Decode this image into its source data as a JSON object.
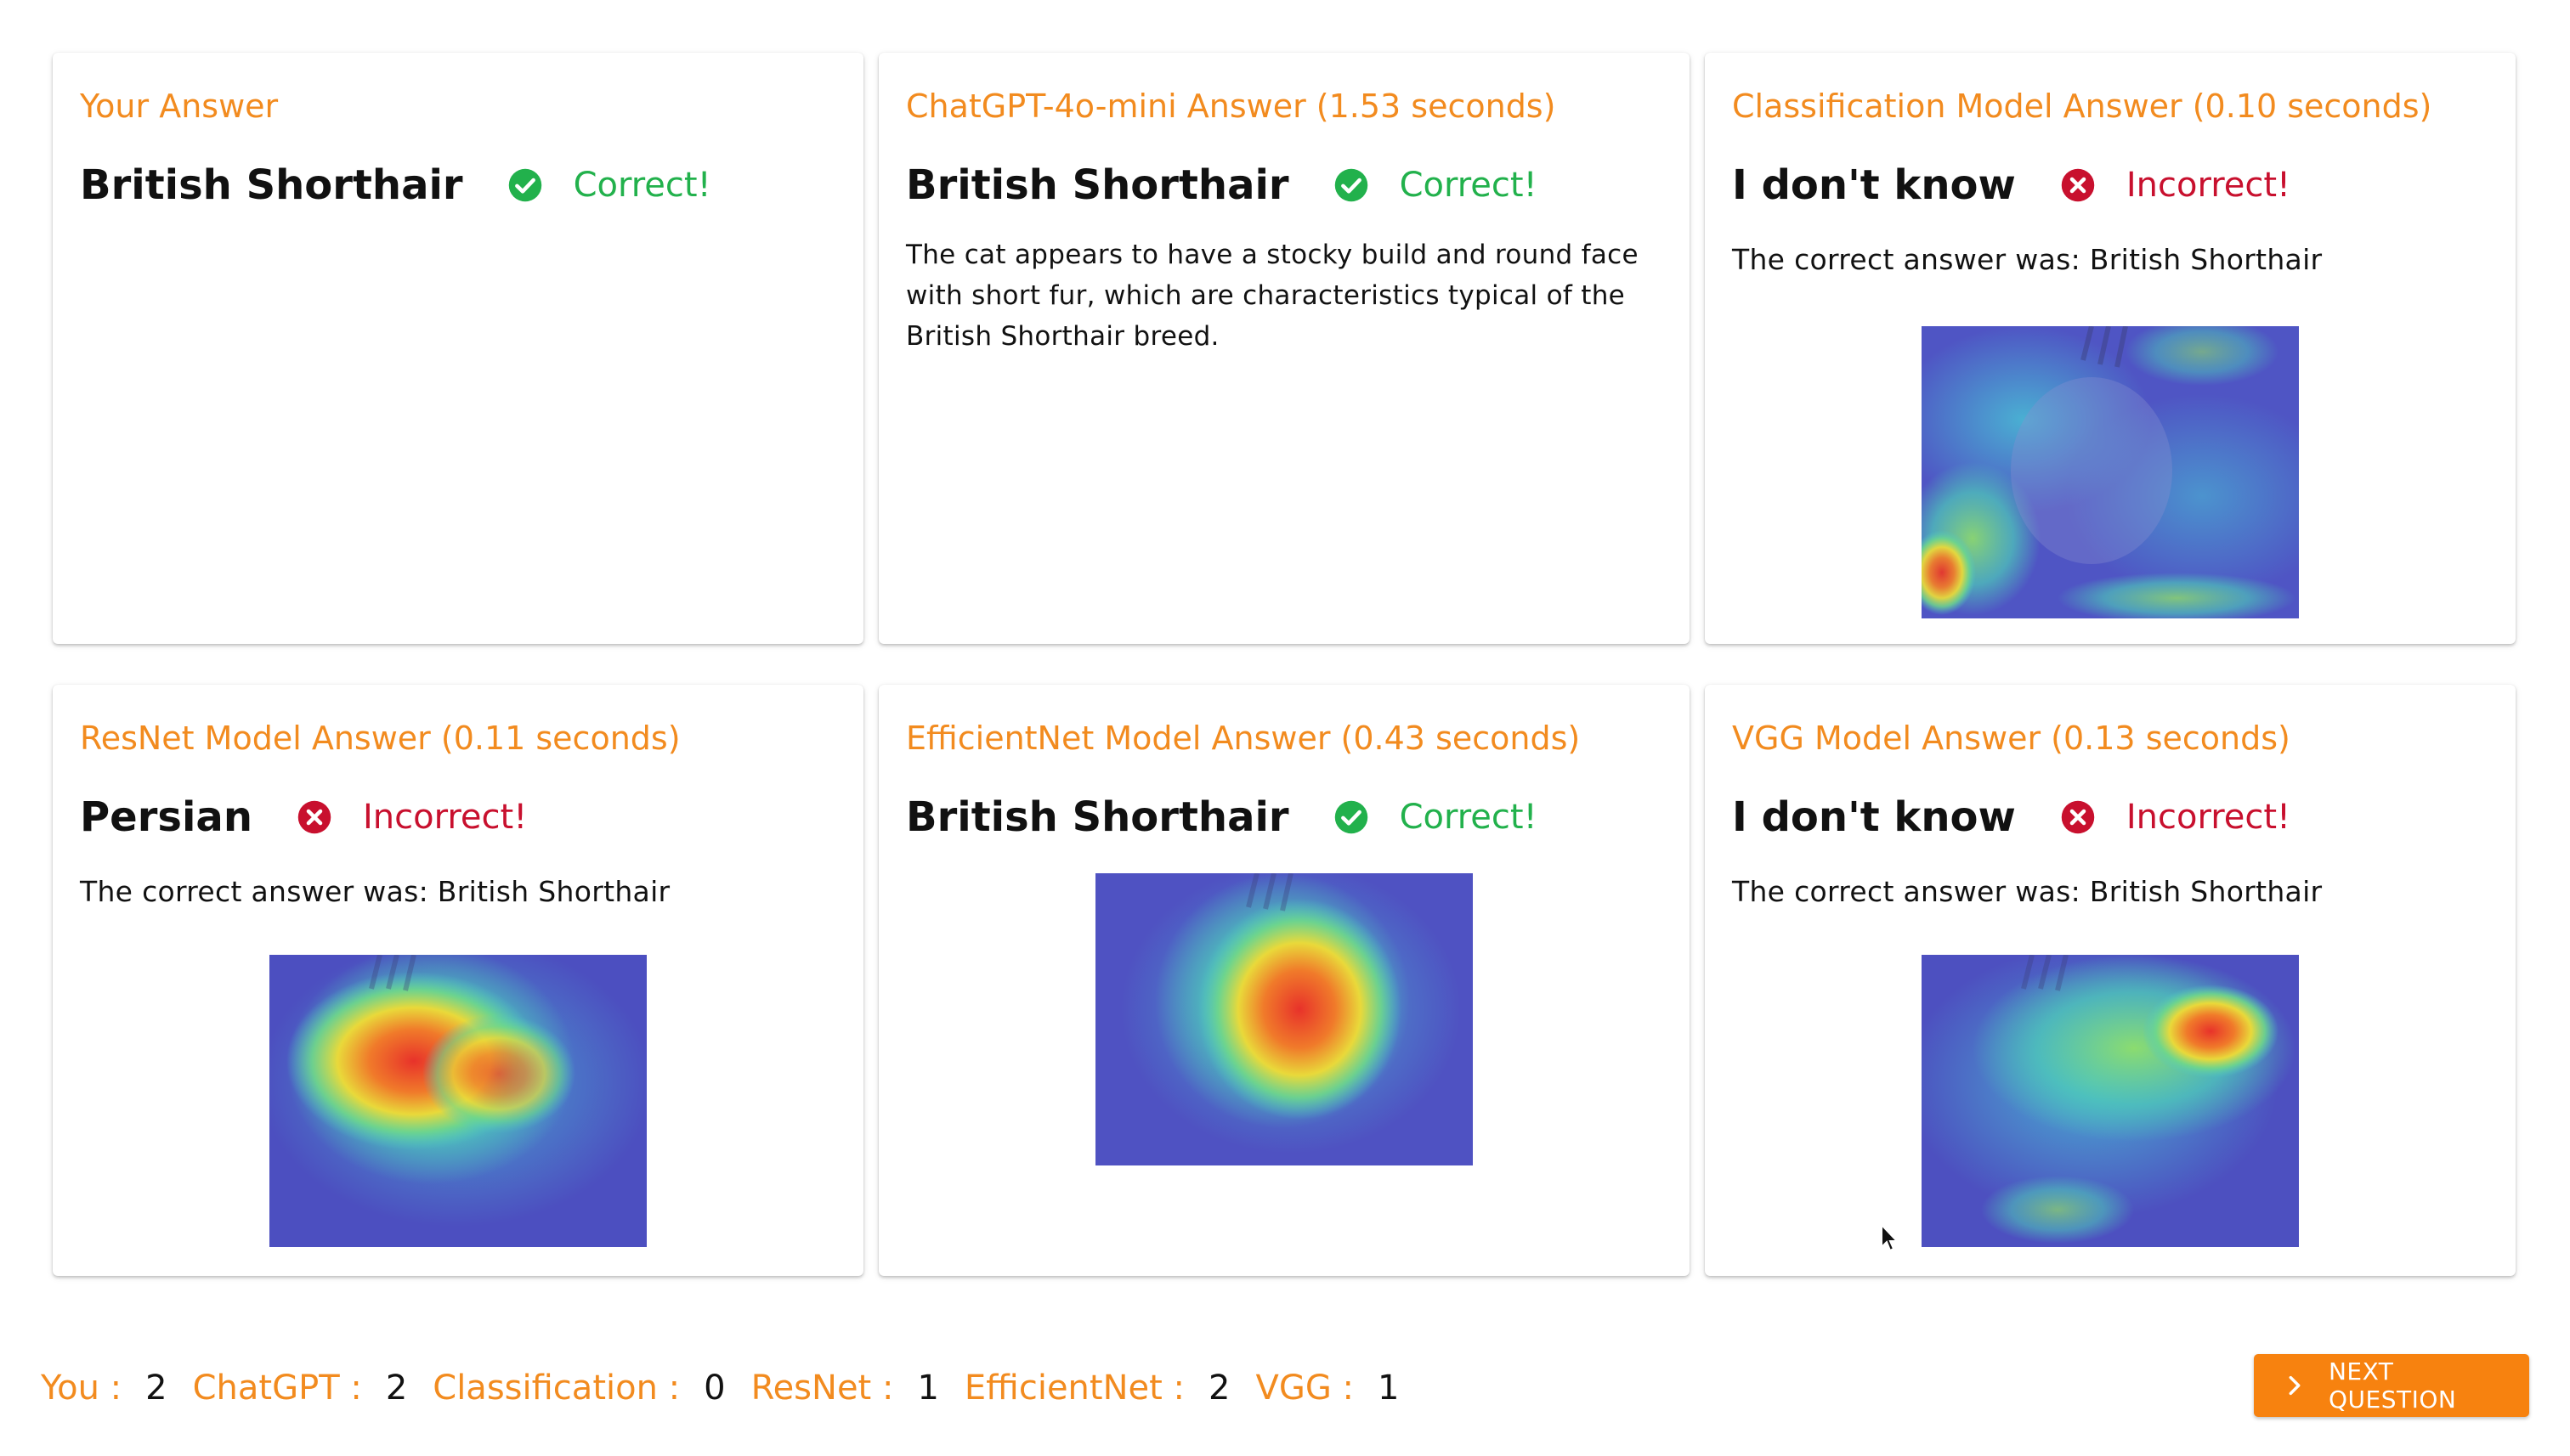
{
  "cards": [
    {
      "title": "Your Answer",
      "answer": "British Shorthair",
      "status": "Correct!"
    },
    {
      "title": "ChatGPT-4o-mini Answer (1.53 seconds)",
      "answer": "British Shorthair",
      "status": "Correct!",
      "explanation": "The cat appears to have a stocky build and round face with short fur, which are characteristics typical of the British Shorthair breed."
    },
    {
      "title": "Classification Model Answer (0.10 seconds)",
      "answer": "I don't know",
      "status": "Incorrect!",
      "correct_line": "The correct answer was: British Shorthair"
    },
    {
      "title": "ResNet Model Answer (0.11 seconds)",
      "answer": "Persian",
      "status": "Incorrect!",
      "correct_line": "The correct answer was: British Shorthair"
    },
    {
      "title": "EfficientNet Model Answer (0.43 seconds)",
      "answer": "British Shorthair",
      "status": "Correct!"
    },
    {
      "title": "VGG Model Answer (0.13 seconds)",
      "answer": "I don't know",
      "status": "Incorrect!",
      "correct_line": "The correct answer was: British Shorthair"
    }
  ],
  "scores": [
    {
      "label": "You :",
      "value": "2"
    },
    {
      "label": "ChatGPT :",
      "value": "2"
    },
    {
      "label": "Classification :",
      "value": "0"
    },
    {
      "label": "ResNet :",
      "value": "1"
    },
    {
      "label": "EfficientNet :",
      "value": "2"
    },
    {
      "label": "VGG :",
      "value": "1"
    }
  ],
  "next_button": {
    "label": "NEXT QUESTION"
  },
  "colors": {
    "accent": "#f28b1f",
    "correct": "#22b14c",
    "incorrect": "#c8102e",
    "button": "#f7820f"
  },
  "icons": {
    "correct": "check-circle-icon",
    "incorrect": "x-circle-icon",
    "next": "chevron-right-icon",
    "cursor": "mouse-pointer-icon"
  }
}
